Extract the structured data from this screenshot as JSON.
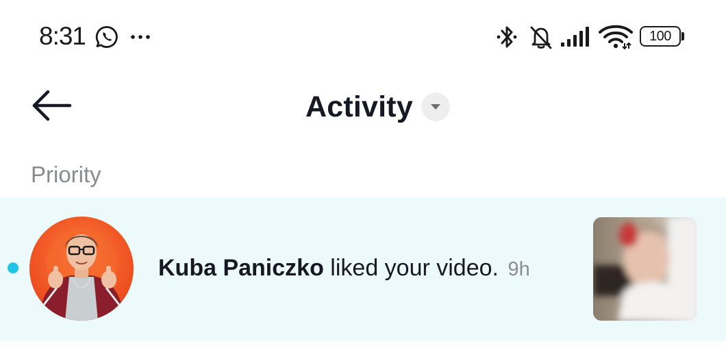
{
  "status_bar": {
    "time": "8:31",
    "battery_level": "100",
    "icons": [
      "whatsapp-icon",
      "more-dots-icon",
      "bluetooth-icon",
      "silent-bell-icon",
      "signal-icon",
      "wifi-icon",
      "battery-icon"
    ]
  },
  "header": {
    "title": "Activity",
    "back_icon": "back-arrow-icon",
    "dropdown_icon": "caret-down-icon"
  },
  "sections": [
    {
      "label": "Priority",
      "notifications": [
        {
          "unread": true,
          "username": "Kuba Paniczko",
          "action": "liked your video.",
          "time": "9h",
          "avatar": "user-avatar",
          "thumbnail": "video-thumbnail"
        }
      ]
    }
  ],
  "colors": {
    "accent_unread": "#20c4e6",
    "row_highlight": "#edfafc",
    "text_primary": "#161823",
    "text_secondary": "#8a8b91"
  }
}
